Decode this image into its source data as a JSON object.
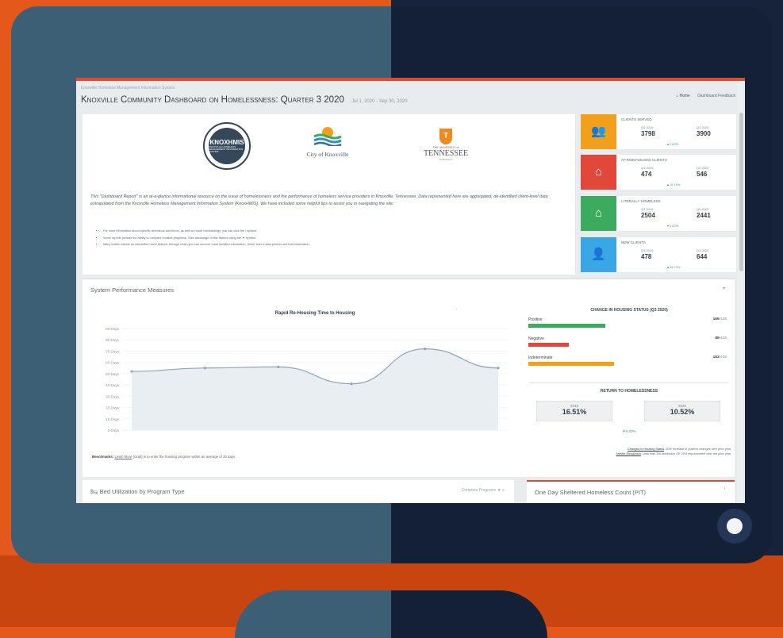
{
  "theme": {
    "accent": "#e04a2f",
    "orange": "#f2a01c",
    "red": "#e2483a",
    "green": "#3cab5d",
    "blue": "#39a6e5"
  },
  "header": {
    "breadcrumb": "Knoxville Homeless Management Information System",
    "title": "Knoxville Community Dashboard on Homelessness: Quarter 3 2020",
    "date_range": "Jul 1, 2020 - Sep 30, 2020",
    "nav_home": "Home",
    "nav_link": "Dashboard Feedback"
  },
  "logos": {
    "hmis_main": "KNOXHMIS",
    "hmis_sub": "KNOXVILLE HOMELESS MANAGEMENT INFORMATION SYSTEM",
    "city": "City of Knoxville",
    "ut_top": "THE UNIVERSITY of",
    "ut_main": "TENNESSEE",
    "ut_bottom": "KNOXVILLE"
  },
  "intro": {
    "text": "This \"Dashboard Report\" is an at-a-glance informational resource on the issue of homelessness and the performance of homeless service providers in Knoxville, Tennessee. Data represented here are aggregated, de-identified client-level data extrapolated from the Knoxville Homeless Management Information System (KnoxHMIS). We have included some helpful tips to assist you in navigating the site:",
    "bullets": [
      "For more information about specific definitions and terms, as well as report methodology, you can click the i symbol.",
      "Some reports provide the ability to compare multiple programs. Take advantage of this feature using the ▼ symbol.",
      "Many charts include an interactive hover feature, through which you can uncover more detailed information. Hover over a data point to see that information."
    ]
  },
  "kpis": [
    {
      "label": "CLIENTS SERVED",
      "y1": "Q3 2019",
      "v1": "3798",
      "y2": "Q3 2020",
      "v2": "3900",
      "change": "▲2.69%",
      "color": "#f2a01c",
      "icon": "users-icon"
    },
    {
      "label": "AT-RISK/HOUSED CLIENTS",
      "y1": "Q3 2019",
      "v1": "474",
      "y2": "Q3 2020",
      "v2": "546",
      "change": "▲15.19%",
      "color": "#e2483a",
      "icon": "home-icon"
    },
    {
      "label": "LITERALLY HOMELESS",
      "y1": "Q3 2019",
      "v1": "2504",
      "y2": "Q3 2020",
      "v2": "2441",
      "change": "▼2.52%",
      "color": "#3cab5d",
      "icon": "home-icon"
    },
    {
      "label": "NEW CLIENTS",
      "y1": "Q3 2019",
      "v1": "478",
      "y2": "Q3 2020",
      "v2": "644",
      "change": "▲34.73%",
      "color": "#39a6e5",
      "icon": "add-user-icon"
    }
  ],
  "spm": {
    "title": "System Performance Measures",
    "benchmark_label": "Benchmarks:",
    "benchmark_link": "Learn More",
    "benchmark_text": "(Goal) is to enter the housing program within an average of 30 days."
  },
  "chart_data": {
    "type": "line",
    "title": "Rapid Re-Housing Time to Housing",
    "y_ticks": [
      "0 Days",
      "10 Days",
      "20 Days",
      "30 Days",
      "40 Days",
      "50 Days",
      "60 Days",
      "70 Days",
      "80 Days",
      "90 Days"
    ],
    "ylim": [
      0,
      90
    ],
    "x": [
      "",
      "",
      "",
      "",
      "",
      ""
    ],
    "series": [
      {
        "values": [
          52,
          55,
          56,
          41,
          72,
          55
        ]
      }
    ],
    "grid": true
  },
  "housing_status": {
    "title": "CHANGE IN HOUSING STATUS (Q3 2020)",
    "rows": [
      {
        "name": "Positive",
        "count": "166",
        "total": "/438",
        "pct": 0.38,
        "color": "#3cab5d"
      },
      {
        "name": "Negative",
        "count": "89",
        "total": "/438",
        "pct": 0.2,
        "color": "#e2483a"
      },
      {
        "name": "Indeterminate",
        "count": "183",
        "total": "/438",
        "pct": 0.42,
        "color": "#f2a01c"
      }
    ],
    "return_title": "RETURN TO HOMELESSNESS",
    "return_boxes": [
      {
        "year": "2019",
        "value": "16.51%"
      },
      {
        "year": "2020",
        "value": "10.52%"
      }
    ],
    "return_change": "▼6.00%",
    "note_1_link": "Changes in Housing Status",
    "note_1": ": 20% increase in positive changes over prior year.",
    "note_2_link": "Shelter Recidivism",
    "note_2": ": Less than 5% recidivism OR 20% improvement over the prior year."
  },
  "bed_panel": {
    "title": "Bed Utilization by Program Type",
    "control": "Compare Programs ▼ ≡"
  },
  "pit_panel": {
    "title": "One Day Sheltered Homeless Count (PIT)",
    "control": "i"
  }
}
